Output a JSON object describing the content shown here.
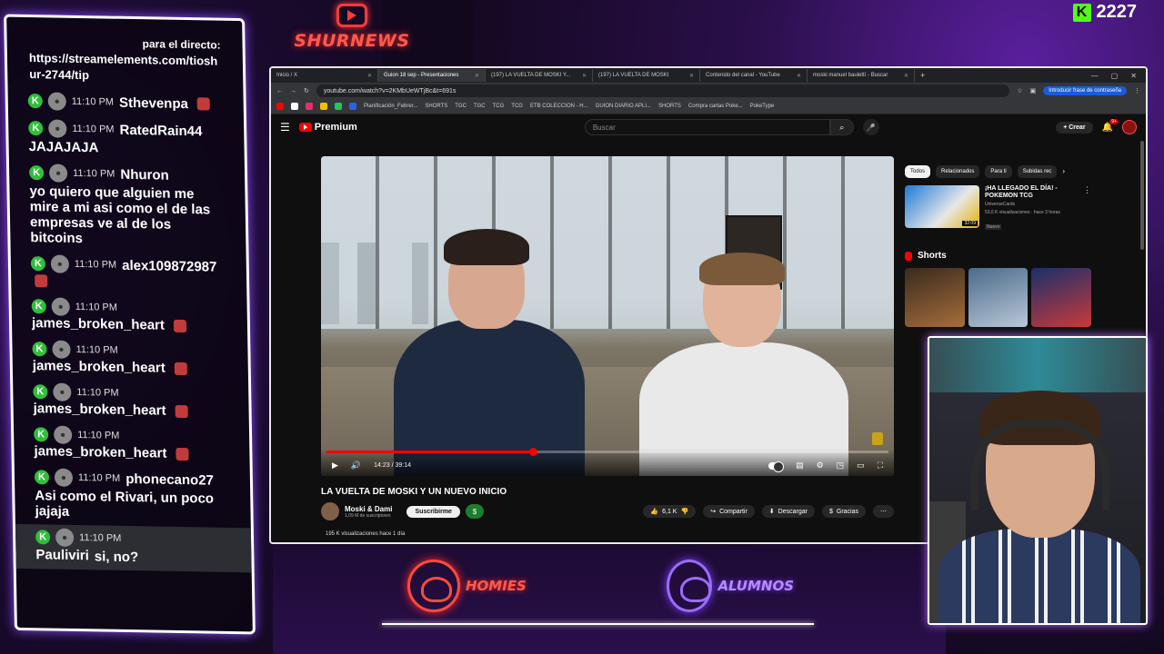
{
  "overlay": {
    "brand": "SHURNEWS",
    "viewer_count": "2227",
    "homies_label": "HOMIES",
    "alumnos_label": "ALUMNOS"
  },
  "chat": {
    "header": "https://streamelements.com/tioshur-2744/tip",
    "header_prefix": "para el directo:",
    "messages": [
      {
        "time": "11:10 PM",
        "user": "Sthevenpa",
        "text": ""
      },
      {
        "time": "11:10 PM",
        "user": "RatedRain44",
        "text": "JAJAJAJA"
      },
      {
        "time": "11:10 PM",
        "user": "Nhuron",
        "text": "yo quiero que alguien me mire a mi asi como el de las empresas ve al de los bitcoins"
      },
      {
        "time": "11:10 PM",
        "user": "alex109872987",
        "text": ""
      },
      {
        "time": "11:10 PM",
        "user": "james_broken_heart",
        "text": ""
      },
      {
        "time": "11:10 PM",
        "user": "james_broken_heart",
        "text": ""
      },
      {
        "time": "11:10 PM",
        "user": "james_broken_heart",
        "text": ""
      },
      {
        "time": "11:10 PM",
        "user": "james_broken_heart",
        "text": ""
      },
      {
        "time": "11:10 PM",
        "user": "phonecano27",
        "text": "Asi como el Rivari, un poco jajaja"
      },
      {
        "time": "11:10 PM",
        "user": "Pauliviri",
        "text": "si, no?"
      }
    ]
  },
  "browser": {
    "tabs": [
      {
        "label": "Inicio / X"
      },
      {
        "label": "Guion 18 sep - Presentaciones"
      },
      {
        "label": "(197) LA VUELTA DE MOSKI Y..."
      },
      {
        "label": "(197) LA VUELTA DE MOSKI"
      },
      {
        "label": "Contenido del canal - YouTube"
      },
      {
        "label": "moski manuel baulettí - Buscar"
      }
    ],
    "url": "youtube.com/watch?v=2KMbUeWTjBc&t=691s",
    "translate_label": "Introducir frase de contraseña",
    "bookmarks": [
      "Planificación_Febrer...",
      "SHORTS",
      "TGC",
      "TGC",
      "TCG",
      "TCG",
      "ETB COLECCION - H...",
      "GUION DIARIO APLI...",
      "SHORTS",
      "Compra cartas Poke...",
      "PokeType"
    ]
  },
  "youtube": {
    "logo": "Premium",
    "search_placeholder": "Buscar",
    "create_label": "Crear",
    "notif_count": "9+",
    "video": {
      "time": "14:23 / 39:14",
      "progress": 0.367,
      "title": "LA VUELTA DE MOSKI Y UN NUEVO INICIO",
      "channel": "Moski & Dami",
      "subs": "1,09 M de suscriptores",
      "subscribe": "Suscribirme",
      "join": "$",
      "likes": "6,1 K",
      "share": "Compartir",
      "download": "Descargar",
      "thanks": "Gracias",
      "views": "195 K visualizaciones  hace 1 día"
    },
    "chips": [
      "Todos",
      "Relacionados",
      "Para ti",
      "Subidas rec"
    ],
    "recommended": {
      "title": "¡HA LLEGADO EL DÍA! - POKEMON TCG",
      "channel": "UniverseCards",
      "meta": "53,6 K visualizaciones · hace 3 horas",
      "badge": "Nuevo",
      "duration": "32:09"
    },
    "shorts_label": "Shorts"
  }
}
